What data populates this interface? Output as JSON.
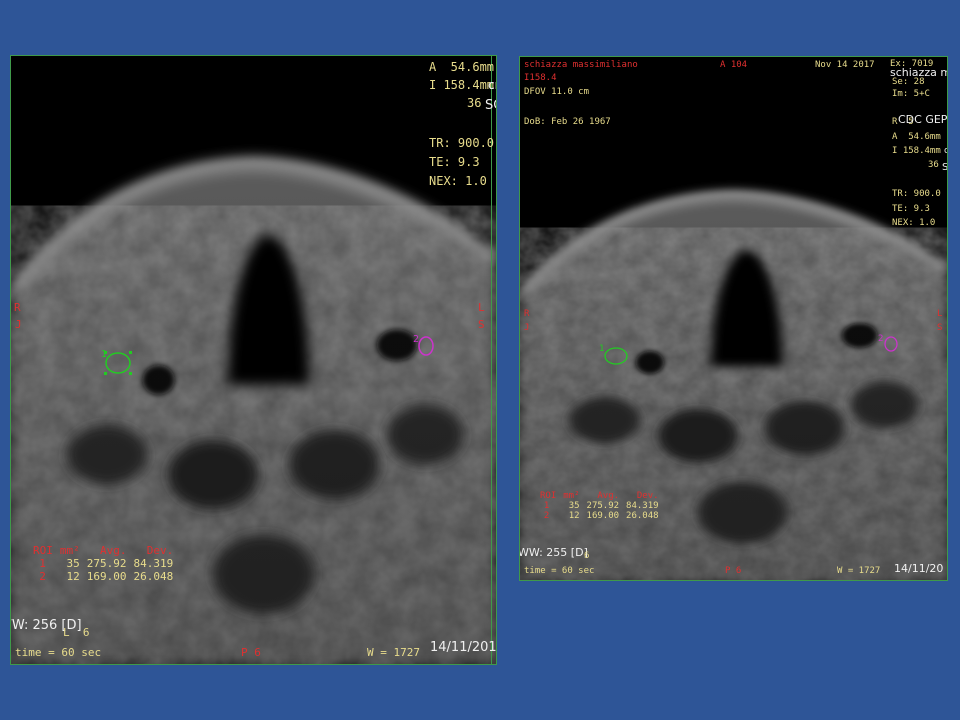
{
  "left_viewer": {
    "top_right": {
      "a_pos": "A  54.6mm",
      "i_pos": "I 158.4mm",
      "partial_cm": "cm",
      "slice": "36",
      "partial_s": "SC",
      "tr": "TR: 900.0",
      "te": "TE: 9.3",
      "nex": "NEX: 1.0"
    },
    "orientation": {
      "left_r": "R",
      "left_j": "J",
      "right_l": "L",
      "right_s": "S"
    },
    "roi_table": {
      "headers": [
        "ROI",
        "mm²",
        "Avg.",
        "Dev."
      ],
      "rows": [
        {
          "roi": "1",
          "area": "35",
          "avg": "275.92",
          "dev": "84.319"
        },
        {
          "roi": "2",
          "area": "12",
          "avg": "169.00",
          "dev": "26.048"
        }
      ]
    },
    "ww": "WW: 256 [D]",
    "ww_partial": "L  6",
    "time": "time = 60 sec",
    "p6": "P 6",
    "w": "W = 1727",
    "date": "14/11/201",
    "roi1_label": "1",
    "roi2_label": "2"
  },
  "right_viewer": {
    "top_left": {
      "patient": "schiazza massimiliano",
      "id": "I158.4",
      "dfov": "DFOV 11.0 cm",
      "dob": "DoB: Feb 26 1967"
    },
    "top_center": "A 104",
    "date_top": "Nov 14 2017",
    "top_right": {
      "ex": "Ex: 7019",
      "name_partial": "schiazza m",
      "se": "Se: 28",
      "im": "Im: 5+C",
      "r_partial": "R  5",
      "cdc": "CDC GEP",
      "a_pos": "A  54.6mm",
      "i_pos": "I 158.4mm",
      "partial_c": "c",
      "slice": "36",
      "partial_s": "S",
      "tr": "TR: 900.0",
      "te": "TE: 9.3",
      "nex": "NEX: 1.0"
    },
    "orientation": {
      "left_r": "R",
      "left_j": "J",
      "right_l": "L",
      "right_s": "S"
    },
    "roi_table": {
      "headers": [
        "ROI",
        "mm²",
        "Avg.",
        "Dev."
      ],
      "rows": [
        {
          "roi": "1",
          "area": "35",
          "avg": "275.92",
          "dev": "84.319"
        },
        {
          "roi": "2",
          "area": "12",
          "avg": "169.00",
          "dev": "26.048"
        }
      ]
    },
    "ww": "WW: 255 [D]",
    "ww_partial": "6",
    "time": "time = 60 sec",
    "p6": "P 6",
    "w": "W = 1727",
    "date": "14/11/20",
    "roi1_label": "1",
    "roi2_label": "2"
  },
  "colors": {
    "background": "#2e5597",
    "overlay_text": "#e8dc8c",
    "overlay_red": "#e03030",
    "roi1": "#22cc22",
    "roi2": "#cc33cc",
    "border": "#3f9a4a"
  }
}
